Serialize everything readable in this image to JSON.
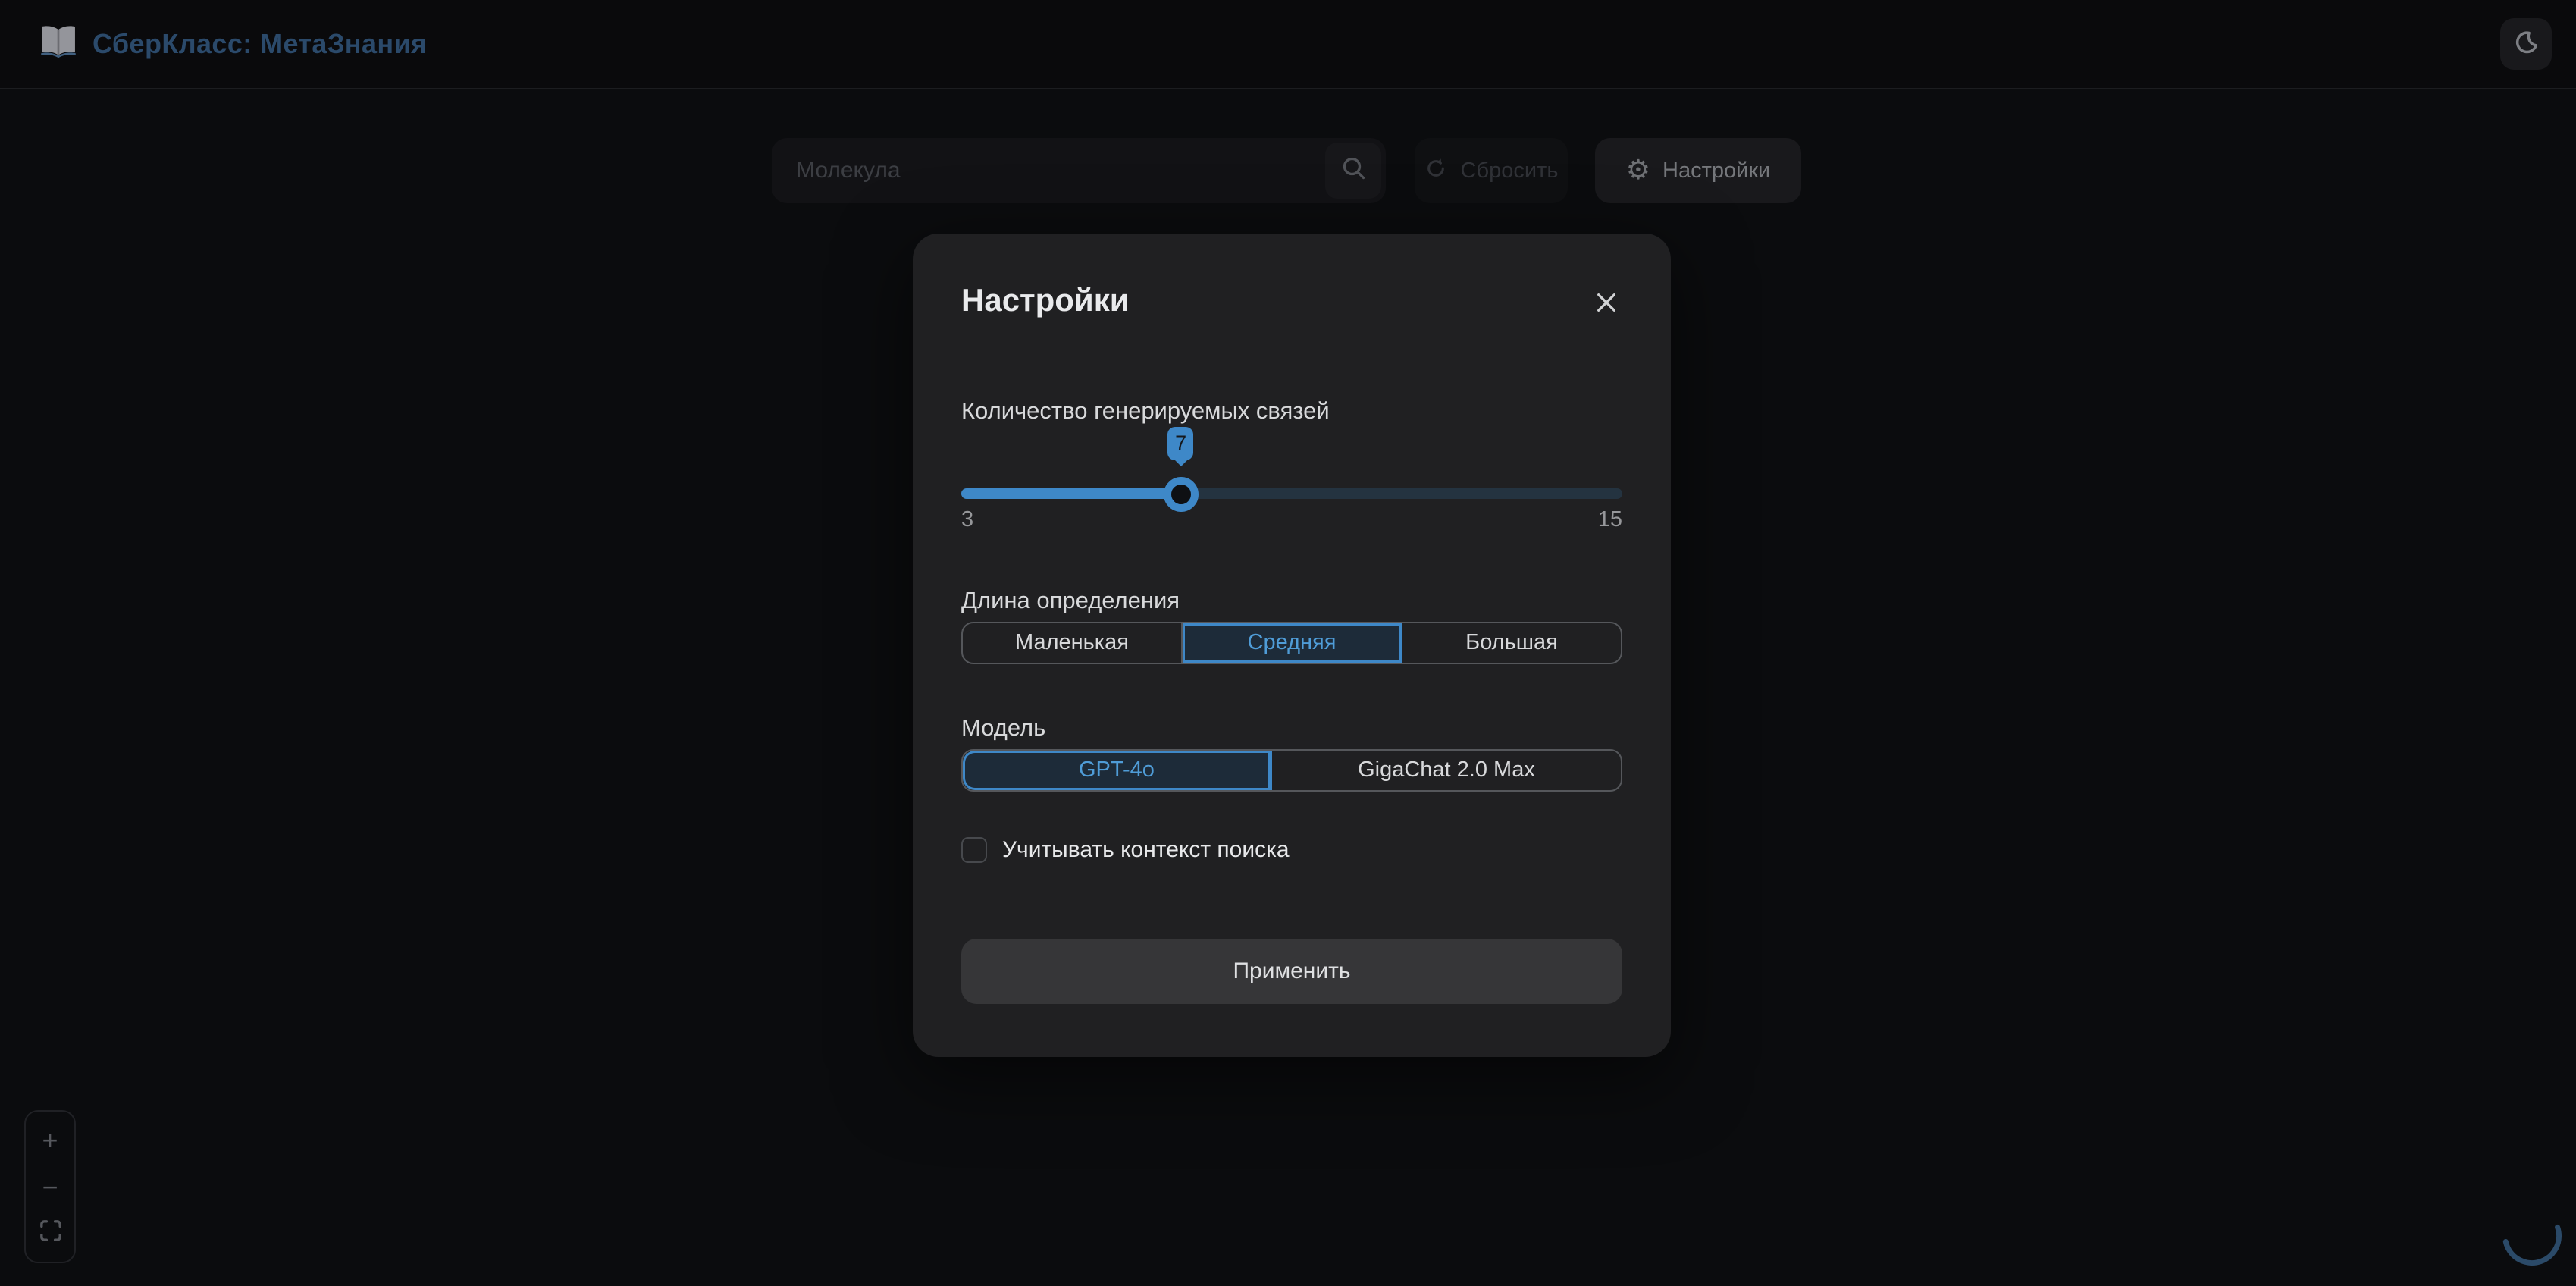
{
  "header": {
    "app_title": "СберКласс: МетаЗнания",
    "logo_icon": "open-book-icon",
    "theme_toggle_icon": "moon-icon"
  },
  "toolbar": {
    "search": {
      "placeholder": "Молекула",
      "value": "",
      "icon": "search-icon"
    },
    "reset_button": {
      "label": "Сбросить",
      "icon": "refresh-icon"
    },
    "settings_button": {
      "label": "Настройки",
      "icon": "gear-icon",
      "gear_glyph": "⚙"
    }
  },
  "modal": {
    "title": "Настройки",
    "close_icon": "close-icon",
    "slider": {
      "label": "Количество генерируемых связей",
      "value": 7,
      "min": 3,
      "max": 15
    },
    "definition_length": {
      "label": "Длина определения",
      "options": [
        "Маленькая",
        "Средняя",
        "Большая"
      ],
      "selected": "Средняя",
      "selected_index": 1
    },
    "model": {
      "label": "Модель",
      "options": [
        "GPT-4o",
        "GigaChat 2.0 Max"
      ],
      "selected": "GPT-4o",
      "selected_index": 0
    },
    "context_checkbox": {
      "label": "Учитывать контекст поиска",
      "checked": false
    },
    "apply_button": {
      "label": "Применить"
    }
  },
  "map_controls": {
    "zoom_in_label": "+",
    "zoom_out_label": "−",
    "fit_icon": "fit-view-icon"
  },
  "status": {
    "loading": true
  },
  "colors": {
    "accent": "#3e88c8",
    "selected_segment_text": "#4f9cd7",
    "brand_title": "#2b4a6b",
    "modal_bg": "#202022",
    "page_bg": "#0b0c0e",
    "spinner": "#2b4a68"
  }
}
